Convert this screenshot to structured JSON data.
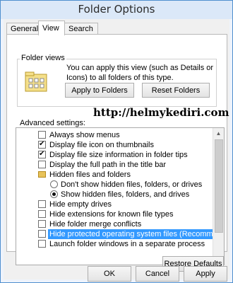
{
  "window": {
    "title": "Folder Options"
  },
  "tabs": [
    {
      "label": "General",
      "active": false
    },
    {
      "label": "View",
      "active": true
    },
    {
      "label": "Search",
      "active": false
    }
  ],
  "folder_views": {
    "label": "Folder views",
    "description": "You can apply this view (such as Details or Icons) to all folders of this type.",
    "apply_label": "Apply to Folders",
    "reset_label": "Reset Folders"
  },
  "watermark": "http://helmykediri.com",
  "advanced": {
    "label": "Advanced settings:",
    "items": [
      {
        "label": "Always show menus",
        "type": "checkbox",
        "checked": false
      },
      {
        "label": "Display file icon on thumbnails",
        "type": "checkbox",
        "checked": true
      },
      {
        "label": "Display file size information in folder tips",
        "type": "checkbox",
        "checked": true
      },
      {
        "label": "Display the full path in the title bar",
        "type": "checkbox",
        "checked": false
      },
      {
        "label": "Hidden files and folders",
        "type": "folder"
      },
      {
        "label": "Don't show hidden files, folders, or drives",
        "type": "radio",
        "selected": false
      },
      {
        "label": "Show hidden files, folders, and drives",
        "type": "radio",
        "selected": true
      },
      {
        "label": "Hide empty drives",
        "type": "checkbox",
        "checked": false
      },
      {
        "label": "Hide extensions for known file types",
        "type": "checkbox",
        "checked": false
      },
      {
        "label": "Hide folder merge conflicts",
        "type": "checkbox",
        "checked": false
      },
      {
        "label": "Hide protected operating system files (Recommended)",
        "type": "checkbox",
        "checked": false,
        "highlighted": true
      },
      {
        "label": "Launch folder windows in a separate process",
        "type": "checkbox",
        "checked": false
      }
    ],
    "restore_label": "Restore Defaults"
  },
  "footer": {
    "ok_label": "OK",
    "cancel_label": "Cancel",
    "apply_label": "Apply"
  },
  "colors": {
    "highlight": "#3399ff",
    "title_bar": "#dbe8f8",
    "border_accent": "#4f8fcf"
  },
  "icons": [
    "folder-view-icon",
    "checkbox-icon",
    "radio-icon",
    "folder-icon",
    "scroll-up-icon",
    "scroll-down-icon"
  ]
}
